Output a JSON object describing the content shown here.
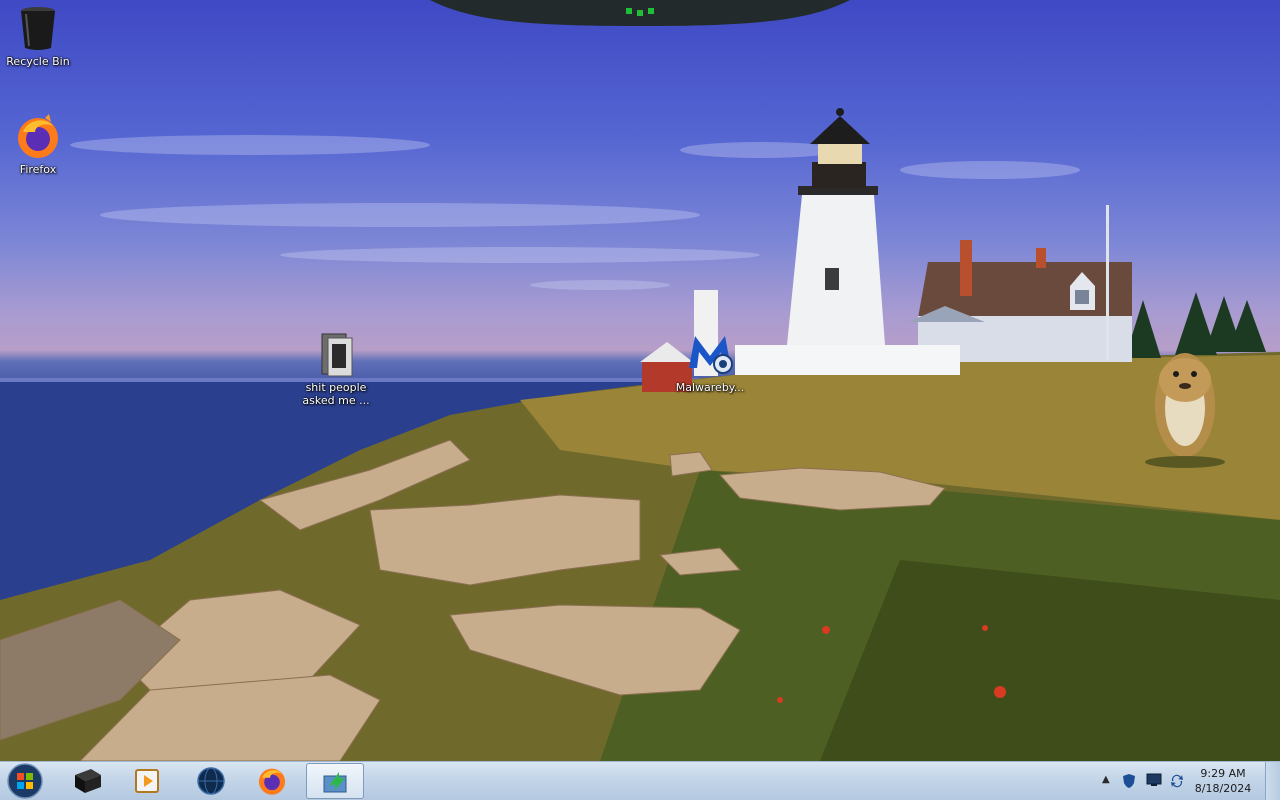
{
  "desktop": {
    "icons": [
      {
        "label": "Recycle Bin",
        "icon": "recycle-bin-icon"
      },
      {
        "label": "Firefox",
        "icon": "firefox-icon"
      },
      {
        "label": "shit people asked me ...",
        "icon": "folder-icon"
      },
      {
        "label": "Malwareby...",
        "icon": "malwarebytes-icon"
      }
    ]
  },
  "taskbar": {
    "start_icon": "windows-start-orb",
    "pinned": [
      {
        "icon": "black-box-app-icon"
      },
      {
        "icon": "media-player-icon"
      },
      {
        "icon": "globe-app-icon"
      },
      {
        "icon": "firefox-icon"
      },
      {
        "icon": "green-arrow-app-icon",
        "active": true
      }
    ],
    "tray": {
      "clock_time": "9:29 AM",
      "clock_date": "8/18/2024",
      "icons": [
        "show-hidden-icons-arrow",
        "shield-icon",
        "network-icon",
        "sync-icon"
      ]
    }
  },
  "colors": {
    "taskbar": "#c3d5e8",
    "sky": "#5566d2",
    "sea": "#1f3578"
  }
}
